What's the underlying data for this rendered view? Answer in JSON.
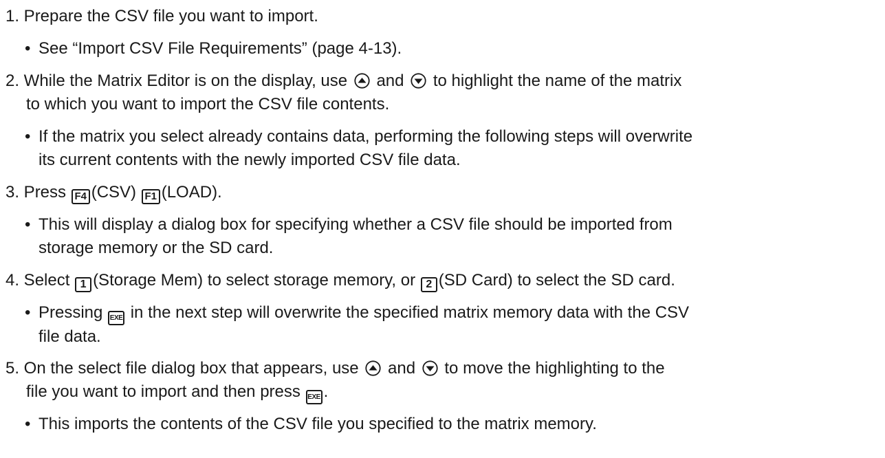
{
  "keys": {
    "f4": "F4",
    "f1": "F1",
    "one": "1",
    "two": "2",
    "exe": "EXE"
  },
  "steps": {
    "s1": {
      "line1": "1. Prepare the CSV file you want to import.",
      "b1": "See “Import CSV File Requirements” (page 4-13)."
    },
    "s2": {
      "p1": "2. While the Matrix Editor is on the display, use",
      "p2": "and",
      "p3": "to highlight the name of the matrix",
      "line2": "to which you want to import the CSV file contents.",
      "b1_line1": "If the matrix you select already contains data, performing the following steps will overwrite",
      "b1_line2": "its current contents with the newly imported CSV file data."
    },
    "s3": {
      "p1": "3. Press",
      "p2": "(CSV)",
      "p3": "(LOAD).",
      "b1_line1": "This will display a dialog box for specifying whether a CSV file should be imported from",
      "b1_line2": "storage memory or the SD card."
    },
    "s4": {
      "p1": "4. Select",
      "p2": "(Storage Mem) to select storage memory, or",
      "p3": "(SD Card) to select the SD card.",
      "b1_p1": "Pressing",
      "b1_p2": "in the next step will overwrite the specified matrix memory data with the CSV",
      "b1_line2": "file data."
    },
    "s5": {
      "p1": "5. On the select file dialog box that appears, use",
      "p2": "and",
      "p3": "to move the highlighting to the",
      "line2_p1": "file you want to import and then press",
      "line2_p2": ".",
      "b1": "This imports the contents of the CSV file you specified to the matrix memory."
    }
  },
  "icons": {
    "up": "up-arrow-key-icon",
    "down": "down-arrow-key-icon"
  }
}
